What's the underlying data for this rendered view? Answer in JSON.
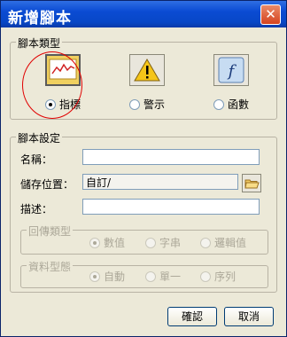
{
  "window": {
    "title": "新增腳本",
    "close_glyph": "✕"
  },
  "script_type": {
    "legend": "腳本類型",
    "options": [
      {
        "label": "指標",
        "icon": "chart-line-icon",
        "selected": true
      },
      {
        "label": "警示",
        "icon": "warning-icon",
        "selected": false
      },
      {
        "label": "函數",
        "icon": "function-icon",
        "selected": false
      }
    ]
  },
  "script_settings": {
    "legend": "腳本設定",
    "name_label": "名稱：",
    "name_value": "",
    "storage_label": "儲存位置：",
    "storage_value": "自訂/",
    "desc_label": "描述：",
    "desc_value": ""
  },
  "return_type": {
    "legend": "回傳類型",
    "options": [
      {
        "label": "數值",
        "selected": true
      },
      {
        "label": "字串",
        "selected": false
      },
      {
        "label": "邏輯值",
        "selected": false
      }
    ]
  },
  "data_type": {
    "legend": "資料型態",
    "options": [
      {
        "label": "自動",
        "selected": true
      },
      {
        "label": "單一",
        "selected": false
      },
      {
        "label": "序列",
        "selected": false
      }
    ]
  },
  "buttons": {
    "ok": "確認",
    "cancel": "取消"
  },
  "colors": {
    "titlebar": "#0a4bd3",
    "highlight_circle": "#e00000",
    "dialog_bg": "#ece9d8"
  }
}
